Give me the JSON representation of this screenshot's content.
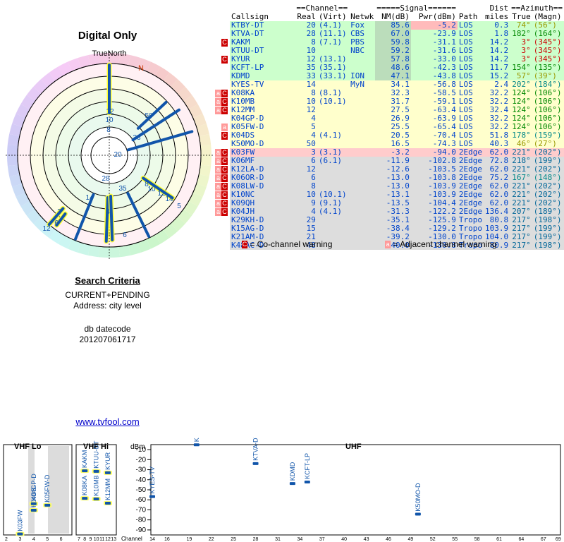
{
  "left_title": "Digital Only",
  "radar": {
    "true_north_label": "TrueNorth",
    "magnetic_north_label": "N",
    "ring_labels": [
      "12",
      "10",
      "8",
      "50",
      "33",
      "20",
      "28",
      "35",
      "14",
      "8",
      "10",
      "12",
      "14",
      "5",
      "3",
      "6",
      "12",
      "4",
      "6"
    ]
  },
  "criteria": {
    "heading": "Search Criteria",
    "line1": "CURRENT+PENDING",
    "line2": "Address: city level",
    "db_label": "db datecode",
    "db_value": "201207061717"
  },
  "link_text": "www.tvfool.com",
  "table": {
    "group_channel": "==Channel==",
    "group_signal": "=====Signal======",
    "group_dist": "Dist",
    "group_azimuth": "==Azimuth==",
    "h_callsign": "Callsign",
    "h_real": "Real",
    "h_virt": "(Virt)",
    "h_netwk": "Netwk",
    "h_nm": "NM(dB)",
    "h_pwr": "Pwr(dBm)",
    "h_path": "Path",
    "h_miles": "miles",
    "h_true": "True",
    "h_magn": "(Magn)",
    "rows": [
      {
        "cs": "KTBY-DT",
        "real": "20",
        "virt": "(4.1)",
        "net": "Fox",
        "nm": "85.6",
        "pwr": "-5.2",
        "path": "LOS",
        "dist": "0.3",
        "az": "74°",
        "mag": "(56°)",
        "band": "green",
        "warn": "",
        "azc": "#999900"
      },
      {
        "cs": "KTVA-DT",
        "real": "28",
        "virt": "(11.1)",
        "net": "CBS",
        "nm": "67.0",
        "pwr": "-23.9",
        "path": "LOS",
        "dist": "1.8",
        "az": "182°",
        "mag": "(164°)",
        "band": "green",
        "warn": "",
        "azc": "#008800"
      },
      {
        "cs": "KAKM",
        "real": "8",
        "virt": "(7.1)",
        "net": "PBS",
        "nm": "59.8",
        "pwr": "-31.1",
        "path": "LOS",
        "dist": "14.2",
        "az": "3°",
        "mag": "(345°)",
        "band": "green",
        "warn": "C",
        "azc": "#cc0000"
      },
      {
        "cs": "KTUU-DT",
        "real": "10",
        "virt": "",
        "net": "NBC",
        "nm": "59.2",
        "pwr": "-31.6",
        "path": "LOS",
        "dist": "14.2",
        "az": "3°",
        "mag": "(345°)",
        "band": "green",
        "warn": "",
        "azc": "#cc0000"
      },
      {
        "cs": "KYUR",
        "real": "12",
        "virt": "(13.1)",
        "net": "",
        "nm": "57.8",
        "pwr": "-33.0",
        "path": "LOS",
        "dist": "14.2",
        "az": "3°",
        "mag": "(345°)",
        "band": "green",
        "warn": "C",
        "azc": "#cc0000"
      },
      {
        "cs": "KCFT-LP",
        "real": "35",
        "virt": "(35.1)",
        "net": "",
        "nm": "48.6",
        "pwr": "-42.3",
        "path": "LOS",
        "dist": "11.7",
        "az": "154°",
        "mag": "(135°)",
        "band": "green",
        "warn": "",
        "azc": "#008800"
      },
      {
        "cs": "KDMD",
        "real": "33",
        "virt": "(33.1)",
        "net": "ION",
        "nm": "47.1",
        "pwr": "-43.8",
        "path": "LOS",
        "dist": "15.2",
        "az": "57°",
        "mag": "(39°)",
        "band": "green",
        "warn": "",
        "azc": "#999900"
      },
      {
        "cs": "KYES-TV",
        "real": "14",
        "virt": "",
        "net": "MyN",
        "nm": "34.1",
        "pwr": "-56.8",
        "path": "LOS",
        "dist": "2.4",
        "az": "202°",
        "mag": "(184°)",
        "band": "yellow",
        "warn": "",
        "azc": "#008888"
      },
      {
        "cs": "K08KA",
        "real": "8",
        "virt": "(8.1)",
        "net": "",
        "nm": "32.3",
        "pwr": "-58.5",
        "path": "LOS",
        "dist": "32.2",
        "az": "124°",
        "mag": "(106°)",
        "band": "yellow",
        "warn": "aC",
        "azc": "#008800"
      },
      {
        "cs": "K10MB",
        "real": "10",
        "virt": "(10.1)",
        "net": "",
        "nm": "31.7",
        "pwr": "-59.1",
        "path": "LOS",
        "dist": "32.2",
        "az": "124°",
        "mag": "(106°)",
        "band": "yellow",
        "warn": "aC",
        "azc": "#008800"
      },
      {
        "cs": "K12MM",
        "real": "12",
        "virt": "",
        "net": "",
        "nm": "27.5",
        "pwr": "-63.4",
        "path": "LOS",
        "dist": "32.4",
        "az": "124°",
        "mag": "(106°)",
        "band": "yellow",
        "warn": "aC",
        "azc": "#008800"
      },
      {
        "cs": "K04GP-D",
        "real": "4",
        "virt": "",
        "net": "",
        "nm": "26.9",
        "pwr": "-63.9",
        "path": "LOS",
        "dist": "32.2",
        "az": "124°",
        "mag": "(106°)",
        "band": "yellow",
        "warn": "",
        "azc": "#008800"
      },
      {
        "cs": "K05FW-D",
        "real": "5",
        "virt": "",
        "net": "",
        "nm": "25.5",
        "pwr": "-65.4",
        "path": "LOS",
        "dist": "32.2",
        "az": "124°",
        "mag": "(106°)",
        "band": "yellow",
        "warn": "a",
        "azc": "#008800"
      },
      {
        "cs": "K04DS",
        "real": "4",
        "virt": "(4.1)",
        "net": "",
        "nm": "20.5",
        "pwr": "-70.4",
        "path": "LOS",
        "dist": "51.8",
        "az": "178°",
        "mag": "(159°)",
        "band": "yellow",
        "warn": "C",
        "azc": "#008888"
      },
      {
        "cs": "K50MO-D",
        "real": "50",
        "virt": "",
        "net": "",
        "nm": "16.5",
        "pwr": "-74.3",
        "path": "LOS",
        "dist": "40.3",
        "az": "46°",
        "mag": "(27°)",
        "band": "yellow",
        "warn": "",
        "azc": "#999900"
      },
      {
        "cs": "K03FW",
        "real": "3",
        "virt": "(3.1)",
        "net": "",
        "nm": "-3.2",
        "pwr": "-94.0",
        "path": "2Edge",
        "dist": "62.0",
        "az": "221°",
        "mag": "(202°)",
        "band": "red",
        "warn": "aC",
        "azc": "#006699"
      },
      {
        "cs": "K06MF",
        "real": "6",
        "virt": "(6.1)",
        "net": "",
        "nm": "-11.9",
        "pwr": "-102.8",
        "path": "2Edge",
        "dist": "72.8",
        "az": "218°",
        "mag": "(199°)",
        "band": "gray",
        "warn": "aC",
        "azc": "#006699"
      },
      {
        "cs": "K12LA-D",
        "real": "12",
        "virt": "",
        "net": "",
        "nm": "-12.6",
        "pwr": "-103.5",
        "path": "2Edge",
        "dist": "62.0",
        "az": "221°",
        "mag": "(202°)",
        "band": "gray",
        "warn": "aC",
        "azc": "#006699"
      },
      {
        "cs": "K06OR-D",
        "real": "6",
        "virt": "",
        "net": "",
        "nm": "-13.0",
        "pwr": "-103.8",
        "path": "2Edge",
        "dist": "75.2",
        "az": "167°",
        "mag": "(148°)",
        "band": "gray",
        "warn": "aC",
        "azc": "#008888"
      },
      {
        "cs": "K08LW-D",
        "real": "8",
        "virt": "",
        "net": "",
        "nm": "-13.0",
        "pwr": "-103.9",
        "path": "2Edge",
        "dist": "62.0",
        "az": "221°",
        "mag": "(202°)",
        "band": "gray",
        "warn": "aC",
        "azc": "#006699"
      },
      {
        "cs": "K10NC",
        "real": "10",
        "virt": "(10.1)",
        "net": "",
        "nm": "-13.1",
        "pwr": "-103.9",
        "path": "2Edge",
        "dist": "62.0",
        "az": "221°",
        "mag": "(202°)",
        "band": "gray",
        "warn": "aC",
        "azc": "#006699"
      },
      {
        "cs": "K09QH",
        "real": "9",
        "virt": "(9.1)",
        "net": "",
        "nm": "-13.5",
        "pwr": "-104.4",
        "path": "2Edge",
        "dist": "62.0",
        "az": "221°",
        "mag": "(202°)",
        "band": "gray",
        "warn": "aC",
        "azc": "#006699"
      },
      {
        "cs": "K04JH",
        "real": "4",
        "virt": "(4.1)",
        "net": "",
        "nm": "-31.3",
        "pwr": "-122.2",
        "path": "2Edge",
        "dist": "136.4",
        "az": "207°",
        "mag": "(189°)",
        "band": "gray",
        "warn": "aC",
        "azc": "#006699"
      },
      {
        "cs": "K29KH-D",
        "real": "29",
        "virt": "",
        "net": "",
        "nm": "-35.1",
        "pwr": "-125.9",
        "path": "Tropo",
        "dist": "80.8",
        "az": "217°",
        "mag": "(198°)",
        "band": "gray",
        "warn": "",
        "azc": "#006699"
      },
      {
        "cs": "K15AG-D",
        "real": "15",
        "virt": "",
        "net": "",
        "nm": "-38.4",
        "pwr": "-129.2",
        "path": "Tropo",
        "dist": "103.9",
        "az": "217°",
        "mag": "(199°)",
        "band": "gray",
        "warn": "",
        "azc": "#006699"
      },
      {
        "cs": "K21AM-D",
        "real": "21",
        "virt": "",
        "net": "",
        "nm": "-39.2",
        "pwr": "-130.0",
        "path": "Tropo",
        "dist": "104.0",
        "az": "217°",
        "mag": "(199°)",
        "band": "gray",
        "warn": "",
        "azc": "#006699"
      },
      {
        "cs": "K48AC-D",
        "real": "48",
        "virt": "",
        "net": "",
        "nm": "-40.0",
        "pwr": "-130.8",
        "path": "Tropo",
        "dist": "80.9",
        "az": "217°",
        "mag": "(198°)",
        "band": "gray",
        "warn": "",
        "azc": "#006699"
      }
    ]
  },
  "legend": {
    "co_mark": "C",
    "co_text": "= Co-channel warning",
    "adj_mark": "a",
    "adj_text": "= Adjacent channel warning"
  },
  "spectrum": {
    "vhf_lo_label": "VHF Lo",
    "vhf_hi_label": "VHF Hi",
    "uhf_label": "UHF",
    "dbm_label": "dBm",
    "channel_label": "Channel",
    "dbm_ticks": [
      "-10",
      "-20",
      "-30",
      "-40",
      "-50",
      "-60",
      "-70",
      "-80",
      "-90"
    ],
    "vhf_lo_channels": [
      "2",
      "3",
      "4",
      "5",
      "6"
    ],
    "vhf_hi_channels": [
      "7",
      "8",
      "9",
      "10",
      "11",
      "12",
      "13"
    ],
    "uhf_channels": [
      "14",
      "16",
      "19",
      "22",
      "25",
      "28",
      "31",
      "34",
      "37",
      "40",
      "43",
      "46",
      "49",
      "52",
      "55",
      "58",
      "61",
      "64",
      "67",
      "69"
    ],
    "markers": [
      {
        "label": "K03FW",
        "ch": 3,
        "dbm": -94
      },
      {
        "label": "K04DS",
        "ch": 4,
        "dbm": -70.4
      },
      {
        "label": "K04GP-D",
        "ch": 4,
        "dbm": -63.9
      },
      {
        "label": "K05FW-D",
        "ch": 5,
        "dbm": -65.4
      },
      {
        "label": "K08KA",
        "ch": 8,
        "dbm": -58.5
      },
      {
        "label": "KAKM",
        "ch": 8,
        "dbm": -31.1
      },
      {
        "label": "K10MB",
        "ch": 10,
        "dbm": -59.1
      },
      {
        "label": "KTUU-DT",
        "ch": 10,
        "dbm": -31.6
      },
      {
        "label": "K12MM",
        "ch": 12,
        "dbm": -63.4
      },
      {
        "label": "KYUR",
        "ch": 12,
        "dbm": -33.0
      },
      {
        "label": "KYES-TV",
        "ch": 14,
        "dbm": -56.8
      },
      {
        "label": "KTBY-DT",
        "ch": 20,
        "dbm": -5.2
      },
      {
        "label": "KTVA-DT",
        "ch": 28,
        "dbm": -23.9
      },
      {
        "label": "KDMD",
        "ch": 33,
        "dbm": -43.8
      },
      {
        "label": "KCFT-LP",
        "ch": 35,
        "dbm": -42.3
      },
      {
        "label": "K50MO-D",
        "ch": 50,
        "dbm": -74.3
      }
    ]
  },
  "colors": {
    "green": "#ccffcc",
    "yellow": "#ffffcc",
    "red": "#ffcccc",
    "gray": "#dddddd",
    "nm_green": "#bbddbb",
    "pwr_hilite": "#ffbbbb",
    "warn_red": "#cc0000",
    "warn_pink": "#ff9999",
    "station_blue": "#1155aa",
    "text_blue": "#0044cc"
  }
}
